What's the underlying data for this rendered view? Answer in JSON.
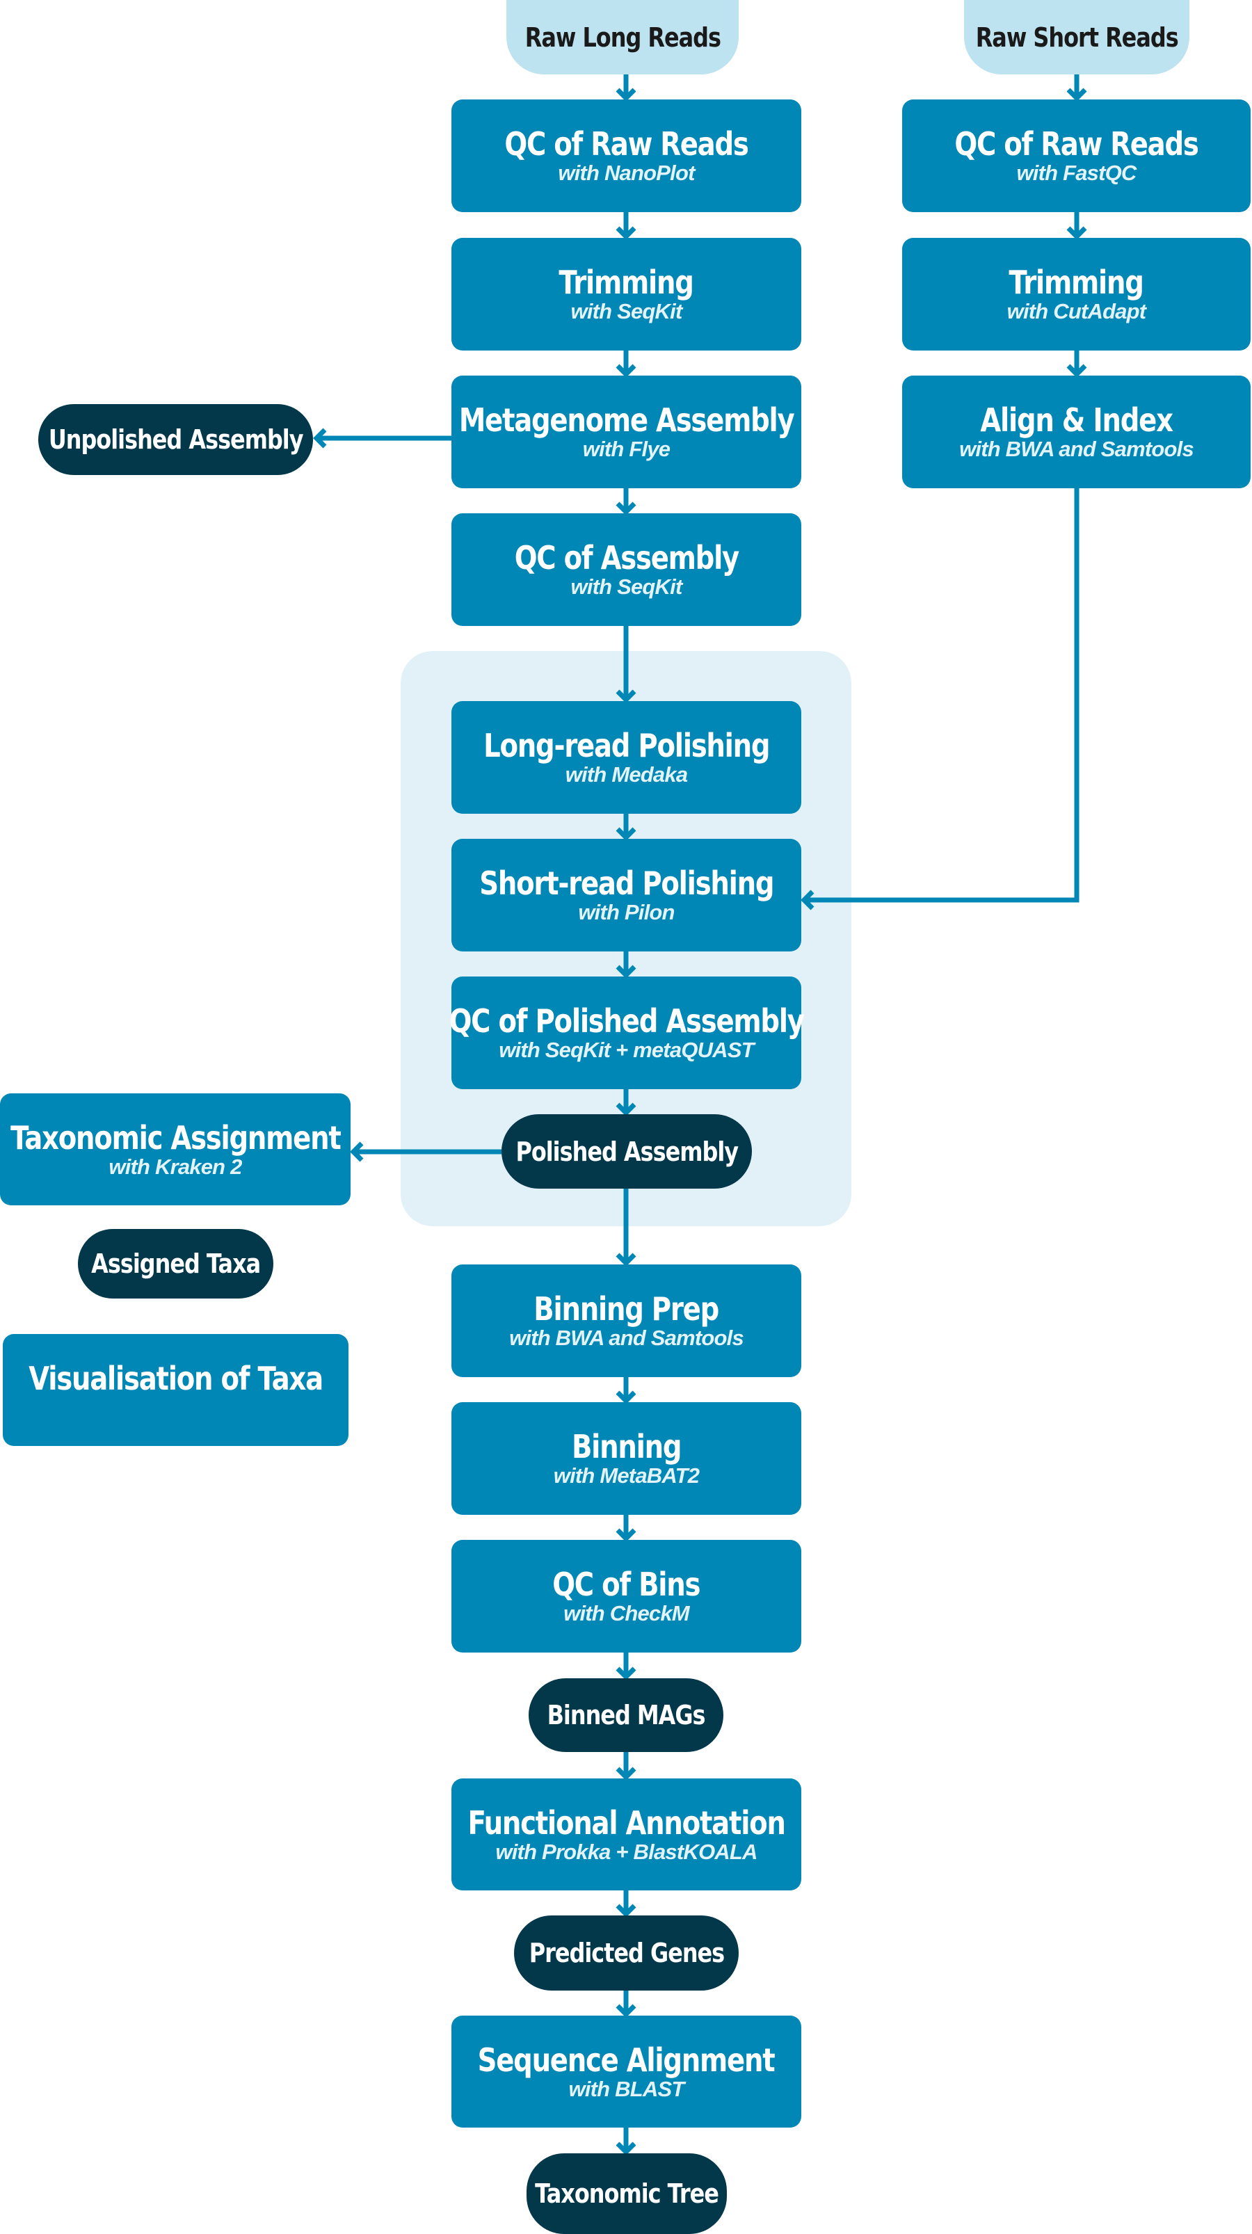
{
  "diagram": {
    "colors": {
      "step_box": "#0087b5",
      "output_pill": "#03374a",
      "input_pill": "#bee3f0",
      "polishing_group": "#e2f1f8",
      "connector": "#0087b5"
    },
    "inputs": {
      "raw_long_reads": "Raw Long Reads",
      "raw_short_reads": "Raw Short Reads"
    },
    "long_read_steps": [
      {
        "title": "QC of Raw Reads",
        "tool": "with NanoPlot"
      },
      {
        "title": "Trimming",
        "tool": "with SeqKit"
      },
      {
        "title": "Metagenome Assembly",
        "tool": "with Flye"
      },
      {
        "title": "QC of Assembly",
        "tool": "with SeqKit"
      }
    ],
    "short_read_steps": [
      {
        "title": "QC of Raw Reads",
        "tool": "with FastQC"
      },
      {
        "title": "Trimming",
        "tool": "with CutAdapt"
      },
      {
        "title": "Align & Index",
        "tool": "with BWA and Samtools"
      }
    ],
    "polishing_steps": [
      {
        "title": "Long-read Polishing",
        "tool": "with Medaka"
      },
      {
        "title": "Short-read Polishing",
        "tool": "with Pilon"
      },
      {
        "title": "QC of Polished Assembly",
        "tool": "with SeqKit + metaQUAST"
      }
    ],
    "taxonomy_branch": {
      "assignment": {
        "title": "Taxonomic Assignment",
        "tool": "with Kraken 2"
      },
      "output": "Assigned Taxa",
      "visualisation": {
        "title": "Visualisation of Taxa"
      }
    },
    "binning_steps": [
      {
        "title": "Binning Prep",
        "tool": "with BWA and Samtools"
      },
      {
        "title": "Binning",
        "tool": "with MetaBAT2"
      },
      {
        "title": "QC of Bins",
        "tool": "with CheckM"
      }
    ],
    "annotation_step": {
      "title": "Functional Annotation",
      "tool": "with Prokka + BlastKOALA"
    },
    "alignment_step": {
      "title": "Sequence Alignment",
      "tool": "with BLAST"
    },
    "outputs": {
      "unpolished_assembly": "Unpolished Assembly",
      "polished_assembly": "Polished Assembly",
      "binned_mags": "Binned MAGs",
      "predicted_genes": "Predicted Genes",
      "taxonomic_tree": "Taxonomic Tree"
    }
  }
}
